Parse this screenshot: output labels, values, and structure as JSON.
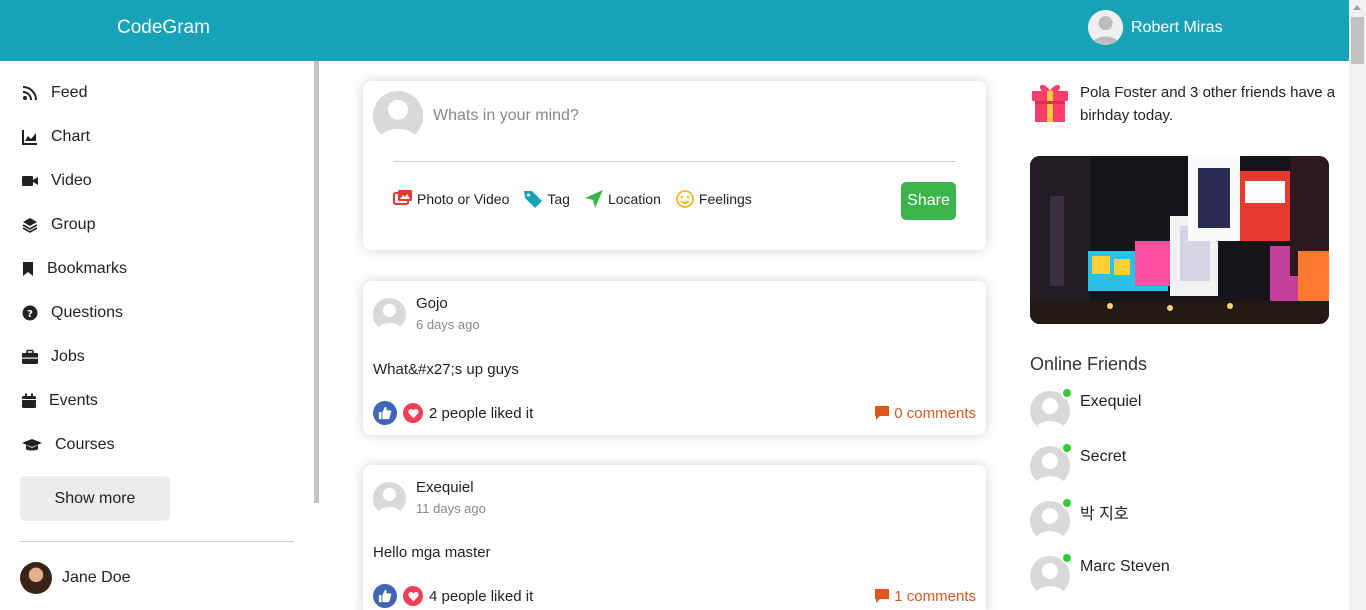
{
  "app": {
    "title": "CodeGram"
  },
  "user": {
    "name": "Robert Miras"
  },
  "sidebar": {
    "items": [
      {
        "label": "Feed",
        "icon": "rss-icon"
      },
      {
        "label": "Chart",
        "icon": "chart-icon"
      },
      {
        "label": "Video",
        "icon": "video-icon"
      },
      {
        "label": "Group",
        "icon": "layers-icon"
      },
      {
        "label": "Bookmarks",
        "icon": "bookmark-icon"
      },
      {
        "label": "Questions",
        "icon": "question-icon"
      },
      {
        "label": "Jobs",
        "icon": "briefcase-icon"
      },
      {
        "label": "Events",
        "icon": "calendar-icon"
      },
      {
        "label": "Courses",
        "icon": "graduation-cap-icon"
      }
    ],
    "show_more": "Show more",
    "friend": {
      "name": "Jane Doe"
    }
  },
  "share": {
    "placeholder": "Whats in your mind?",
    "options": [
      {
        "label": "Photo or Video",
        "icon": "photo-icon",
        "color": "#e53935"
      },
      {
        "label": "Tag",
        "icon": "tag-icon",
        "color": "#17a2b8"
      },
      {
        "label": "Location",
        "icon": "location-icon",
        "color": "#3bb54a"
      },
      {
        "label": "Feelings",
        "icon": "smile-icon",
        "color": "#f0b429"
      }
    ],
    "button": "Share"
  },
  "posts": [
    {
      "author": "Gojo",
      "time": "6 days ago",
      "text": "What&#x27;s up guys",
      "likes": "2 people liked it",
      "comments": "0 comments"
    },
    {
      "author": "Exequiel",
      "time": "11 days ago",
      "text": "Hello mga master",
      "likes": "4 people liked it",
      "comments": "1 comments"
    }
  ],
  "birthday": {
    "text": "Pola Foster and 3 other friends have a birhday today."
  },
  "online": {
    "title": "Online Friends",
    "friends": [
      {
        "name": "Exequiel"
      },
      {
        "name": "Secret"
      },
      {
        "name": "박 지호"
      },
      {
        "name": "Marc Steven"
      }
    ]
  },
  "colors": {
    "brand": "#17a2b8",
    "share": "#3bb54a",
    "comments": "#e0561f",
    "online": "#32cd32",
    "like": "#4267b2",
    "love": "#f33e58"
  }
}
